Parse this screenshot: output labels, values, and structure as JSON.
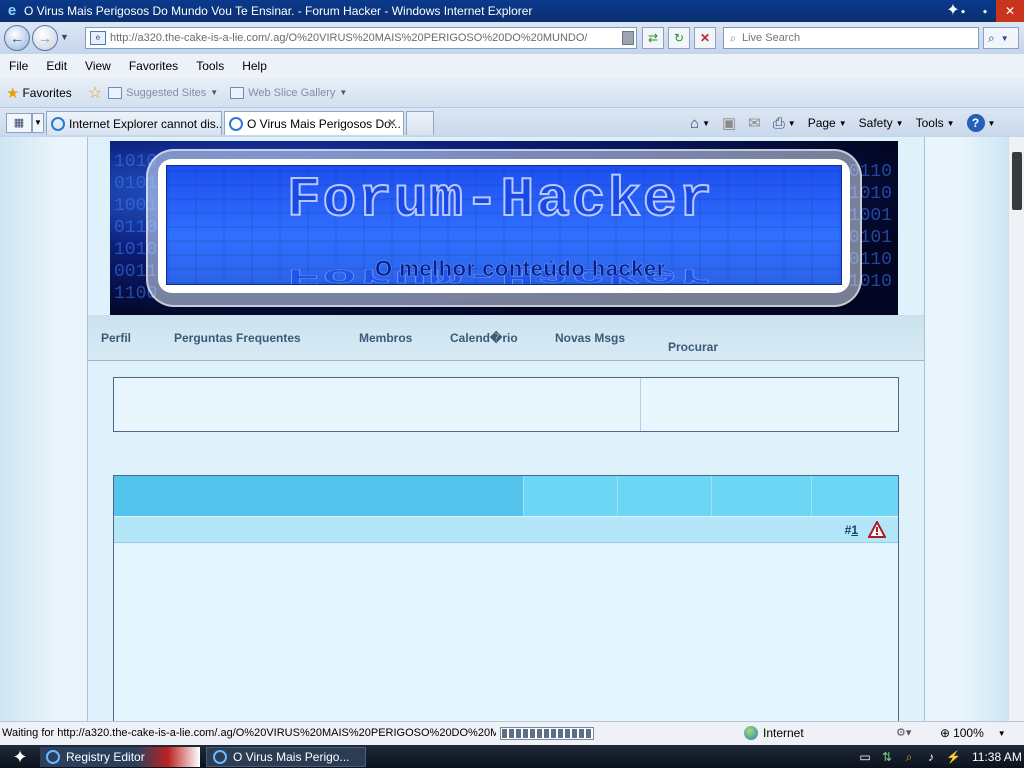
{
  "window": {
    "title": "O Virus Mais Perigosos Do Mundo Vou Te Ensinar. - Forum Hacker - Windows Internet Explorer"
  },
  "address_bar": {
    "url": "http://a320.the-cake-is-a-lie.com/.ag/O%20VIRUS%20MAIS%20PERIGOSO%20DO%20MUNDO/",
    "search_placeholder": "Live Search"
  },
  "menu": [
    "File",
    "Edit",
    "View",
    "Favorites",
    "Tools",
    "Help"
  ],
  "favorites_bar": {
    "favorites_label": "Favorites",
    "links": [
      "Suggested Sites",
      "Web Slice Gallery"
    ]
  },
  "tabs": [
    {
      "label": "Internet Explorer cannot dis...",
      "active": false
    },
    {
      "label": "O Virus Mais Perigosos Do...",
      "active": true
    }
  ],
  "command_bar": {
    "page_label": "Page",
    "safety_label": "Safety",
    "tools_label": "Tools"
  },
  "banner": {
    "title": "Forum-Hacker",
    "tagline": "O melhor conteúdo hacker"
  },
  "forum_nav": {
    "perfil": "Perfil",
    "faq": "Perguntas Frequentes",
    "membros": "Membros",
    "calendario": "Calend�rio",
    "novas": "Novas Msgs",
    "procurar": "Procurar"
  },
  "post": {
    "number": "1",
    "hash": "#"
  },
  "status_bar": {
    "text": "Waiting for http://a320.the-cake-is-a-lie.com/.ag/O%20VIRUS%20MAIS%20PERIGOSO%20DO%20M",
    "zone": "Internet",
    "zoom": "100%",
    "progress": 1.0
  },
  "taskbar": {
    "tasks": [
      "Registry Editor",
      "O Virus Mais Perigo..."
    ],
    "clock": "11:38 AM"
  },
  "colors": {
    "titlebar": "#0a3a8c",
    "header_cell": "#55c4ec",
    "nav_text": "#3c5a78"
  }
}
